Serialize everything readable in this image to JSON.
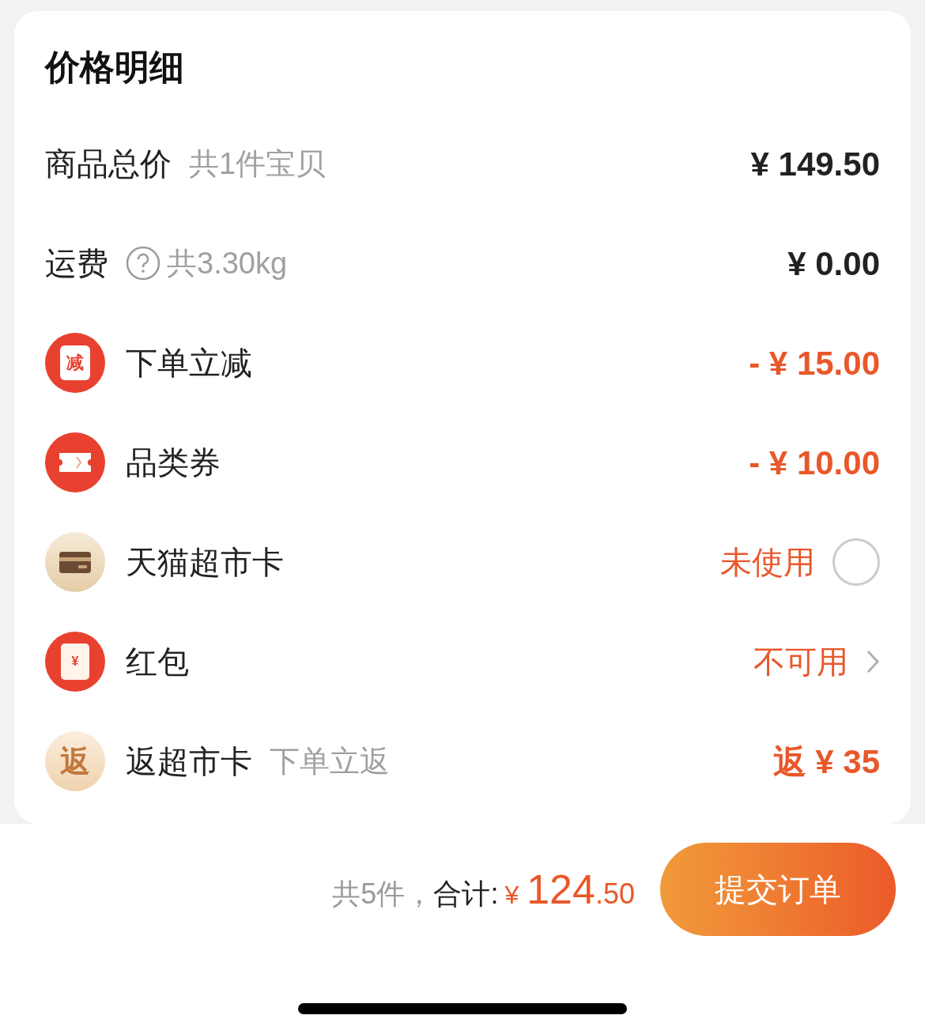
{
  "title": "价格明细",
  "rows": [
    {
      "kind": "plain",
      "label": "商品总价",
      "note": "共1件宝贝",
      "value": "¥ 149.50"
    },
    {
      "kind": "plain",
      "label": "运费",
      "help_icon": true,
      "note": "共3.30kg",
      "value": "¥ 0.00"
    },
    {
      "kind": "amount",
      "icon_text": "减",
      "label": "下单立减",
      "value": "- ¥ 15.00"
    },
    {
      "kind": "amount",
      "label": "品类券",
      "value": "- ¥ 10.00"
    },
    {
      "kind": "toggle",
      "label": "天猫超市卡",
      "value": "未使用",
      "checked": false
    },
    {
      "kind": "link",
      "icon_text": "¥",
      "label": "红包",
      "value": "不可用"
    },
    {
      "kind": "amount",
      "icon_text": "返",
      "label": "返超市卡",
      "note": "下单立返",
      "value": "返 ¥ 35"
    }
  ],
  "footer": {
    "count": "共5件，",
    "total_label": "合计:",
    "currency": "¥",
    "total_integer": "124",
    "total_decimal": ".50",
    "submit": "提交订单"
  }
}
